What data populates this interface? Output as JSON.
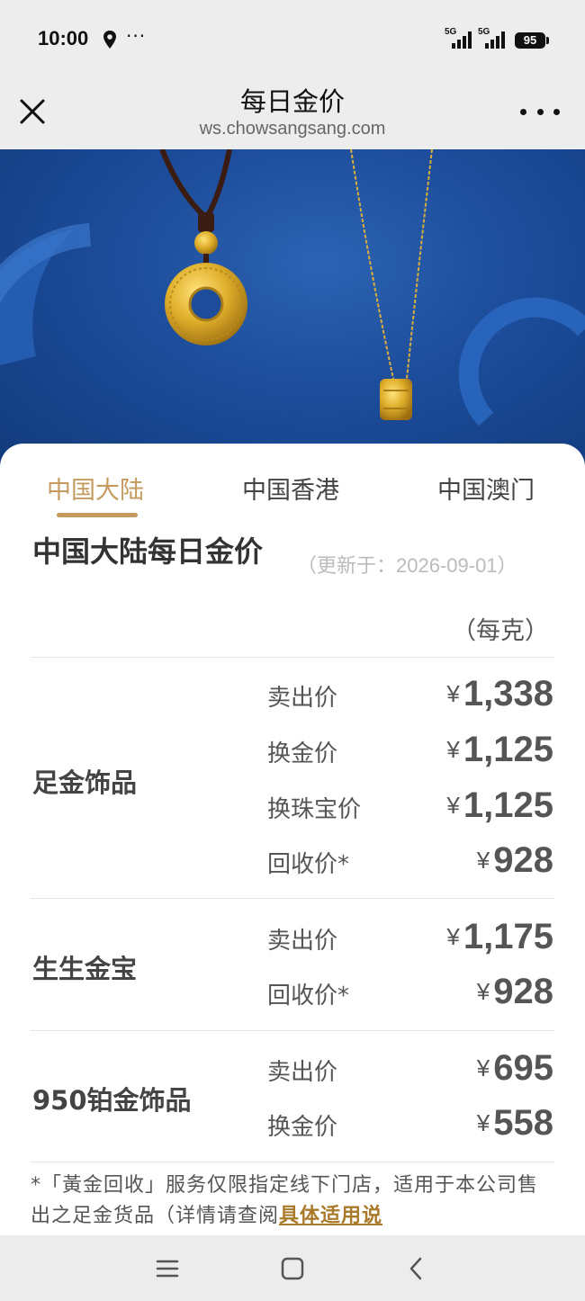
{
  "status": {
    "time": "10:00",
    "signal1_label": "5G",
    "signal2_label": "5G",
    "battery": "95",
    "icons": [
      "location-icon",
      "more-dots-icon",
      "signal-icon",
      "battery-icon"
    ]
  },
  "titlebar": {
    "title": "每日金价",
    "url": "ws.chowsangsang.com",
    "icons": [
      "close-icon",
      "more-icon"
    ]
  },
  "tabs": [
    {
      "label": "中国大陆",
      "active": true
    },
    {
      "label": "中国香港",
      "active": false
    },
    {
      "label": "中国澳门",
      "active": false
    }
  ],
  "section": {
    "title": "中国大陆每日金价",
    "updated": "（更新于：2026-09-01）",
    "unit": "（每克）"
  },
  "categories": [
    {
      "name": "足金饰品",
      "prices": [
        {
          "label": "卖出价",
          "currency": "¥",
          "value": "1,338"
        },
        {
          "label": "换金价",
          "currency": "¥",
          "value": "1,125"
        },
        {
          "label": "换珠宝价",
          "currency": "¥",
          "value": "1,125"
        },
        {
          "label": "回收价*",
          "currency": "¥",
          "value": "928"
        }
      ]
    },
    {
      "name": "生生金宝",
      "prices": [
        {
          "label": "卖出价",
          "currency": "¥",
          "value": "1,175"
        },
        {
          "label": "回收价*",
          "currency": "¥",
          "value": "928"
        }
      ]
    },
    {
      "name": "950铂金饰品",
      "prices": [
        {
          "label": "卖出价",
          "currency": "¥",
          "value": "695"
        },
        {
          "label": "换金价",
          "currency": "¥",
          "value": "558"
        }
      ]
    }
  ],
  "footnote": {
    "text": "*「黃金回收」服务仅限指定线下门店，适用于本公司售出之足金货品（详情请查阅",
    "link": "具体适用说"
  },
  "colors": {
    "accent": "#c49a5e",
    "link": "#a97a2a",
    "banner": "#1c4c9a"
  },
  "navbar": {
    "icons": [
      "menu-icon",
      "home-icon",
      "back-icon"
    ]
  }
}
